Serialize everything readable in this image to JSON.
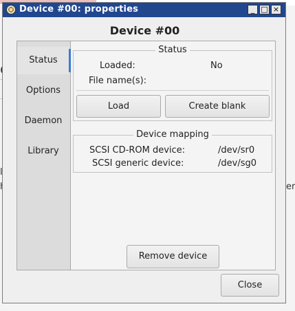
{
  "background": {
    "fragment_left_1": "d",
    "fragment_left_2": "l",
    "fragment_left_3": "h",
    "fragment_right": "er"
  },
  "window": {
    "title": "Device #00: properties",
    "controls": {
      "minimize": "_",
      "maximize": "□",
      "close": "×"
    }
  },
  "heading": "Device #00",
  "tabs": [
    {
      "label": "Status",
      "active": true
    },
    {
      "label": "Options"
    },
    {
      "label": "Daemon"
    },
    {
      "label": "Library"
    }
  ],
  "status_frame": {
    "legend": "Status",
    "loaded_label": "Loaded:",
    "loaded_value": "No",
    "filenames_label": "File name(s):",
    "filenames_value": "",
    "load_button": "Load",
    "create_blank_button": "Create blank"
  },
  "mapping_frame": {
    "legend": "Device mapping",
    "rows": [
      {
        "label": "SCSI CD-ROM device:",
        "value": "/dev/sr0"
      },
      {
        "label": "SCSI generic device:",
        "value": "/dev/sg0"
      }
    ]
  },
  "remove_button": "Remove device",
  "close_button": "Close"
}
